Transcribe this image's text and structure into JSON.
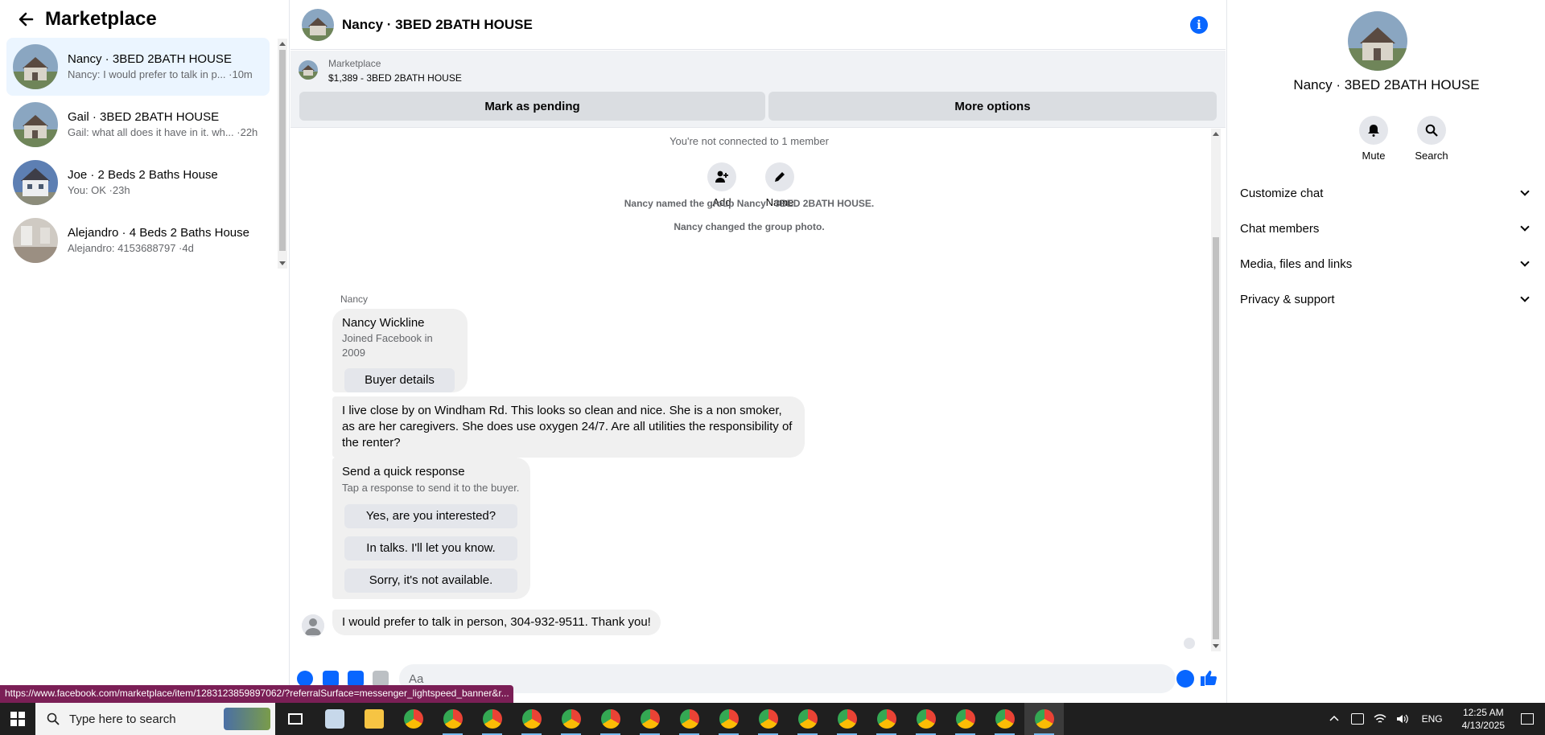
{
  "sidebar": {
    "title": "Marketplace",
    "conversations": [
      {
        "name": "Nancy · 3BED 2BATH HOUSE",
        "preview": "Nancy: I would prefer to talk in p... ·10m",
        "active": true
      },
      {
        "name": "Gail · 3BED 2BATH HOUSE",
        "preview": "Gail: what all does it have in it. wh... ·22h",
        "active": false
      },
      {
        "name": "Joe · 2 Beds 2 Baths House",
        "preview": "You: OK ·23h",
        "active": false
      },
      {
        "name": "Alejandro · 4 Beds 2 Baths House",
        "preview": "Alejandro: 4153688797 ·4d",
        "active": false
      }
    ]
  },
  "chat": {
    "title": "Nancy · 3BED 2BATH HOUSE",
    "listing": {
      "label": "Marketplace",
      "price_title": "$1,389 - 3BED 2BATH HOUSE",
      "mark_pending": "Mark as pending",
      "more_options": "More options"
    },
    "not_connected": "You're not connected to 1 member",
    "actions": {
      "add": "Add",
      "name": "Name"
    },
    "system_msgs": [
      "Nancy named the group Nancy · 3BED 2BATH HOUSE.",
      "Nancy changed the group photo."
    ],
    "sender": "Nancy",
    "profile_card": {
      "name": "Nancy Wickline",
      "joined": "Joined Facebook in 2009",
      "button": "Buyer details"
    },
    "message1": "I live close by on Windham Rd. This looks so clean and nice. She is a non smoker, as are her caregivers. She does use oxygen 24/7. Are all utilities the responsibility of the renter?",
    "quick_response": {
      "title": "Send a quick response",
      "subtitle": "Tap a response to send it to the buyer.",
      "options": [
        "Yes, are you interested?",
        "In talks. I'll let you know.",
        "Sorry, it's not available."
      ]
    },
    "last_message": "I would prefer to talk in person, 304-932-9511. Thank you!",
    "composer_placeholder": "Aa"
  },
  "details": {
    "title": "Nancy · 3BED 2BATH HOUSE",
    "mute": "Mute",
    "search": "Search",
    "sections": [
      "Customize chat",
      "Chat members",
      "Media, files and links",
      "Privacy & support"
    ]
  },
  "status_url": "https://www.facebook.com/marketplace/item/1283123859897062/?referralSurface=messenger_lightspeed_banner&r...",
  "taskbar": {
    "search_placeholder": "Type here to search",
    "lang": "ENG",
    "time": "12:25 AM",
    "date": "4/13/2025"
  },
  "colors": {
    "accent": "#0866ff",
    "active_row": "#ebf5ff",
    "bubble": "#f0f0f0"
  }
}
